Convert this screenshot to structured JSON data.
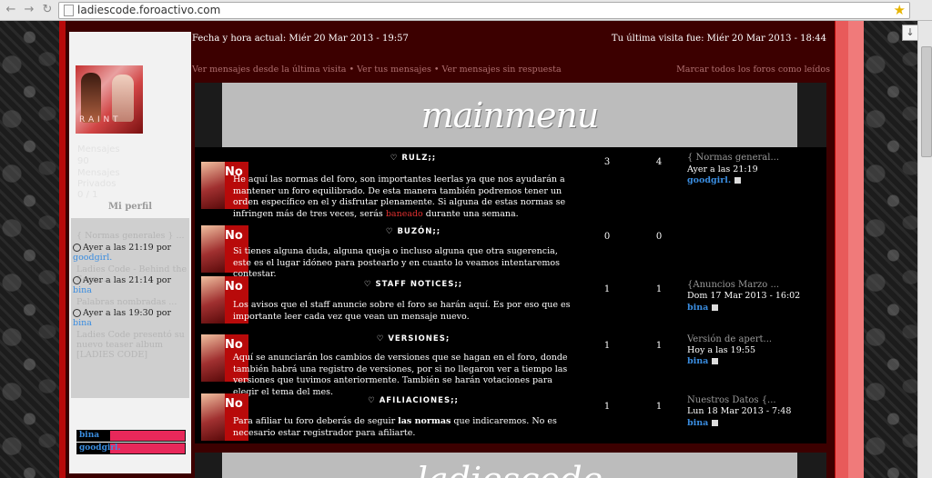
{
  "browser": {
    "url": "ladiescode.foroactivo.com",
    "back_icon": "back-arrow-icon",
    "forward_icon": "forward-arrow-icon",
    "star_icon": "bookmark-star-icon"
  },
  "header": {
    "date_now": "Fecha y hora actual: Miér 20 Mar 2013 - 19:57",
    "last_visit": "Tu última visita fue: Miér 20 Mar 2013 - 18:44",
    "links_left": "Ver mensajes desde la última visita • Ver tus mensajes • Ver mensajes sin respuesta",
    "links_right": "Marcar todos los foros como leídos"
  },
  "sidebar": {
    "info_lines": [
      "Mensajes",
      "90",
      "Mensajes",
      "Privados",
      "0 / 1"
    ],
    "profile_link": "Mi perfil",
    "recent": [
      {
        "title": "{ Normas generales } ...",
        "meta": "Ayer a las 21:19 por",
        "user": "goodgirl."
      },
      {
        "title": "Ladies Code - Behind the Scen...",
        "meta": "Ayer a las 21:14 por",
        "user": "bina"
      },
      {
        "title": "Palabras nombradas ...",
        "meta": "Ayer a las 19:30 por",
        "user": "bina"
      },
      {
        "title": "Ladies Code presentó su nuevo teaser album [LADIES CODE]",
        "meta": "",
        "user": ""
      }
    ],
    "online": [
      {
        "name": "bina"
      },
      {
        "name": "goodgirl."
      }
    ]
  },
  "category": {
    "banner": "mainmenu",
    "next_banner": "ladiescode"
  },
  "forums": [
    {
      "title": "RULZ;;",
      "desc_parts": [
        "He aquí las normas del foro, son importantes leerlas ya que nos ayudarán a mantener un foro equilibrado. De esta manera también podremos tener un orden específico en el y disfrutar plenamente. Si alguna de estas normas se infringen más de tres veces, serás ",
        "baneado",
        " durante una semana."
      ],
      "topics": "3",
      "posts": "4",
      "last_title": "{ Normas general...",
      "last_date": "Ayer a las 21:19",
      "last_user": "goodgirl."
    },
    {
      "title": "BUZÓN;;",
      "desc_parts": [
        "Si tienes alguna duda, alguna queja o incluso alguna que otra sugerencia, este es el lugar idóneo para postearlo y en cuanto lo veamos intentaremos contestar."
      ],
      "topics": "0",
      "posts": "0",
      "last_title": "",
      "last_date": "",
      "last_user": ""
    },
    {
      "title": "STAFF NOTICES;;",
      "desc_parts": [
        "Los avisos que el staff anuncie sobre el foro se harán aquí. Es por eso que es importante leer cada vez que vean un mensaje nuevo."
      ],
      "topics": "1",
      "posts": "1",
      "last_title": "{Anuncios Marzo ...",
      "last_date": "Dom 17 Mar 2013 - 16:02",
      "last_user": "bina"
    },
    {
      "title": "VERSIONES;",
      "desc_parts": [
        "Aquí se anunciarán los cambios de versiones que se hagan en el foro, donde también habrá una registro de versiones, por si no llegaron ver a tiempo las versiones que tuvimos anteriormente. También se harán votaciones para elegir el tema del mes."
      ],
      "topics": "1",
      "posts": "1",
      "last_title": "Versión de apert...",
      "last_date": "Hoy a las 19:55",
      "last_user": "bina"
    },
    {
      "title": "AFILIACIONES;;",
      "desc_parts": [
        "Para afiliar tu foro deberás de seguir ",
        "las normas",
        " que indicaremos. No es necesario estar registrador para afiliarte."
      ],
      "topics": "1",
      "posts": "1",
      "last_title": "Nuestros Datos {...",
      "last_date": "Lun 18 Mar 2013 - 7:48",
      "last_user": "bina"
    }
  ],
  "icon_label": "No",
  "colors": {
    "accent_red": "#b80a0a",
    "dark_red": "#3c0000",
    "link_blue": "#3a8de0",
    "pink": "#e8285a"
  }
}
